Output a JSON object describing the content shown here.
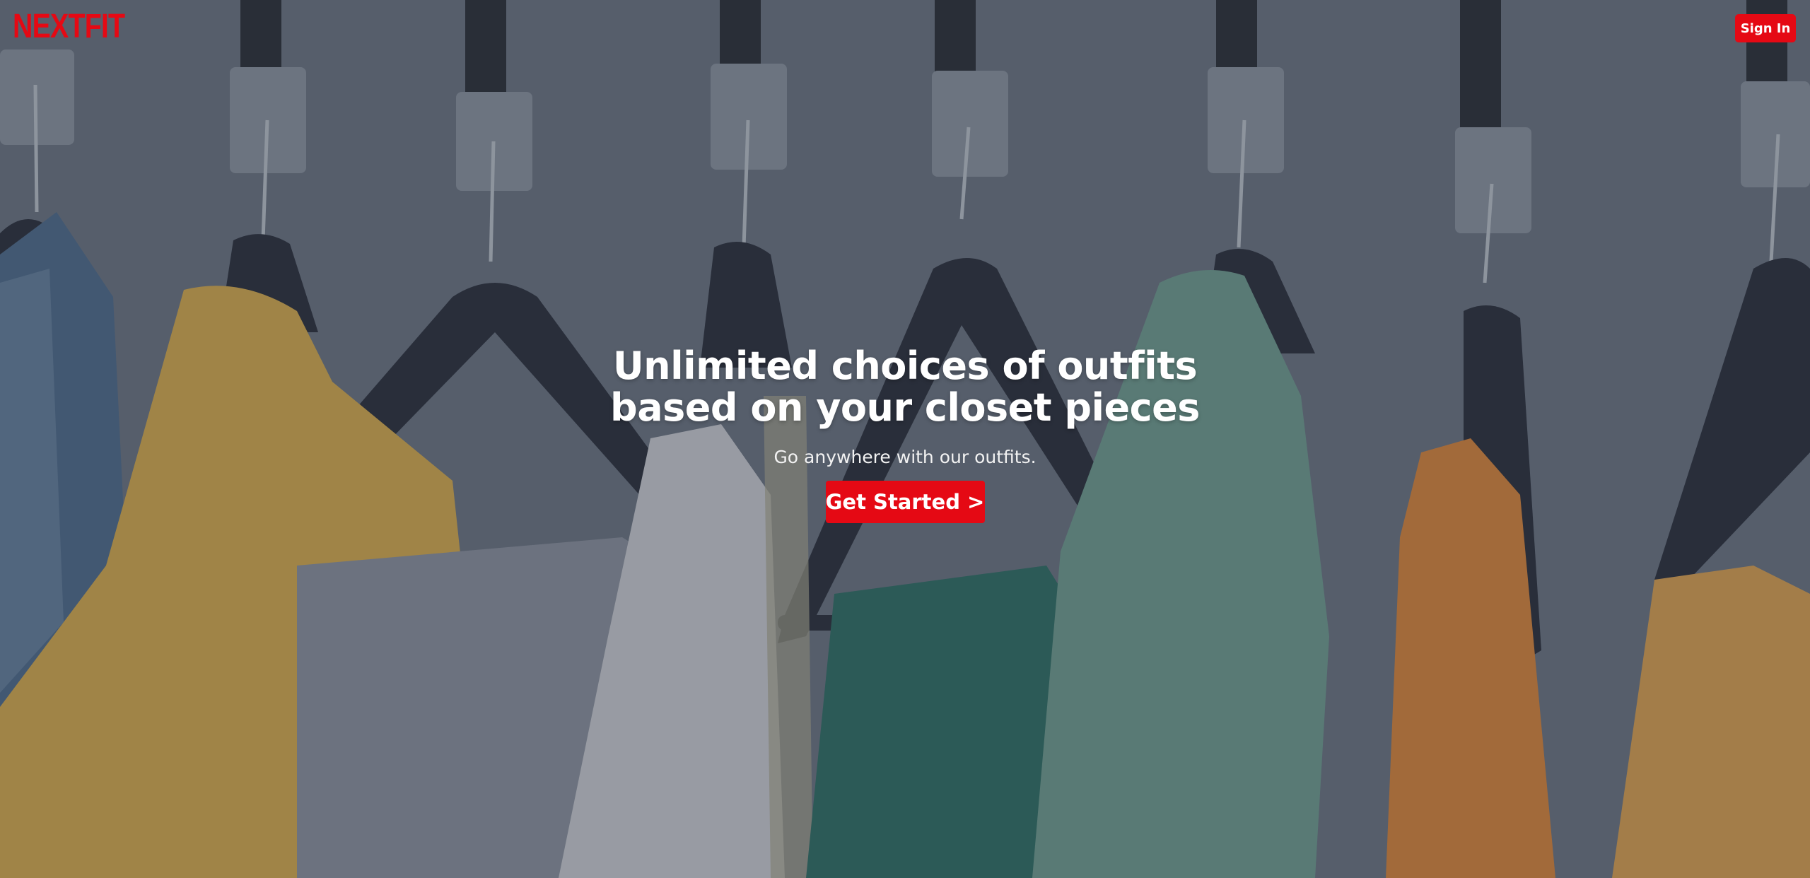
{
  "brand": {
    "logo_text": "NEXTFIT",
    "accent_color": "#e50914"
  },
  "header": {
    "sign_in_label": "Sign In"
  },
  "hero": {
    "headline_line1": "Unlimited choices of outfits",
    "headline_line2": "based on your closet pieces",
    "subtitle": "Go anywhere with our outfits.",
    "cta_label": "Get Started >"
  }
}
